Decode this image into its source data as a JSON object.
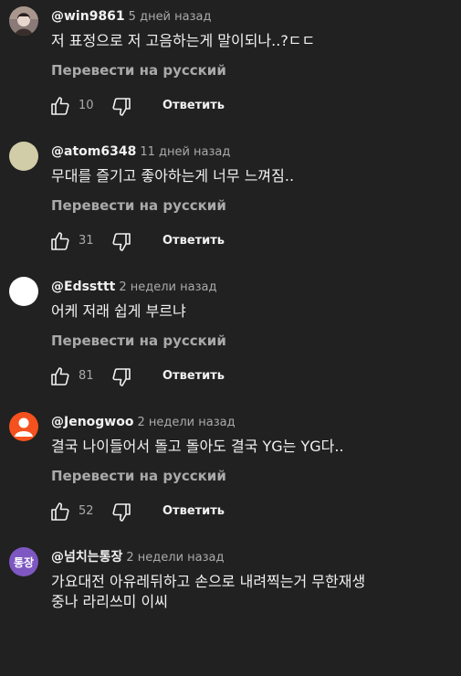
{
  "comments": [
    {
      "author": "@win9861",
      "time": "5 дней назад",
      "text": "저 표정으로 저 고음하는게 말이되나..?ㄷㄷ",
      "translate_label": "Перевести на русский",
      "likes": "10",
      "reply_label": "Ответить",
      "avatar": {
        "type": "photo",
        "color": "#8a7a78"
      }
    },
    {
      "author": "@atom6348",
      "time": "11 дней назад",
      "text": "무대를 즐기고 좋아하는게 너무 느껴짐..",
      "translate_label": "Перевести на русский",
      "likes": "31",
      "reply_label": "Ответить",
      "avatar": {
        "type": "solid",
        "color": "#d1cda8"
      }
    },
    {
      "author": "@Edssttt",
      "time": "2 недели назад",
      "text": "어케 저래 쉽게 부르냐",
      "translate_label": "Перевести на русский",
      "likes": "81",
      "reply_label": "Ответить",
      "avatar": {
        "type": "solid",
        "color": "#ffffff"
      }
    },
    {
      "author": "@Jenogwoo",
      "time": "2 недели назад",
      "text": "결국 나이들어서 돌고 돌아도 결국 YG는 YG다..",
      "translate_label": "Перевести на русский",
      "likes": "52",
      "reply_label": "Ответить",
      "avatar": {
        "type": "default-person",
        "color": "#f4511e"
      }
    },
    {
      "author": "@넘치는통장",
      "time": "2 недели назад",
      "text_line1": "가요대전 아유레뒤하고 손으로 내려찍는거 무한재생",
      "text_line2": "중나 라리쓰미 이씨",
      "avatar": {
        "type": "text",
        "color": "#7e57c2",
        "label": "통장"
      }
    }
  ]
}
